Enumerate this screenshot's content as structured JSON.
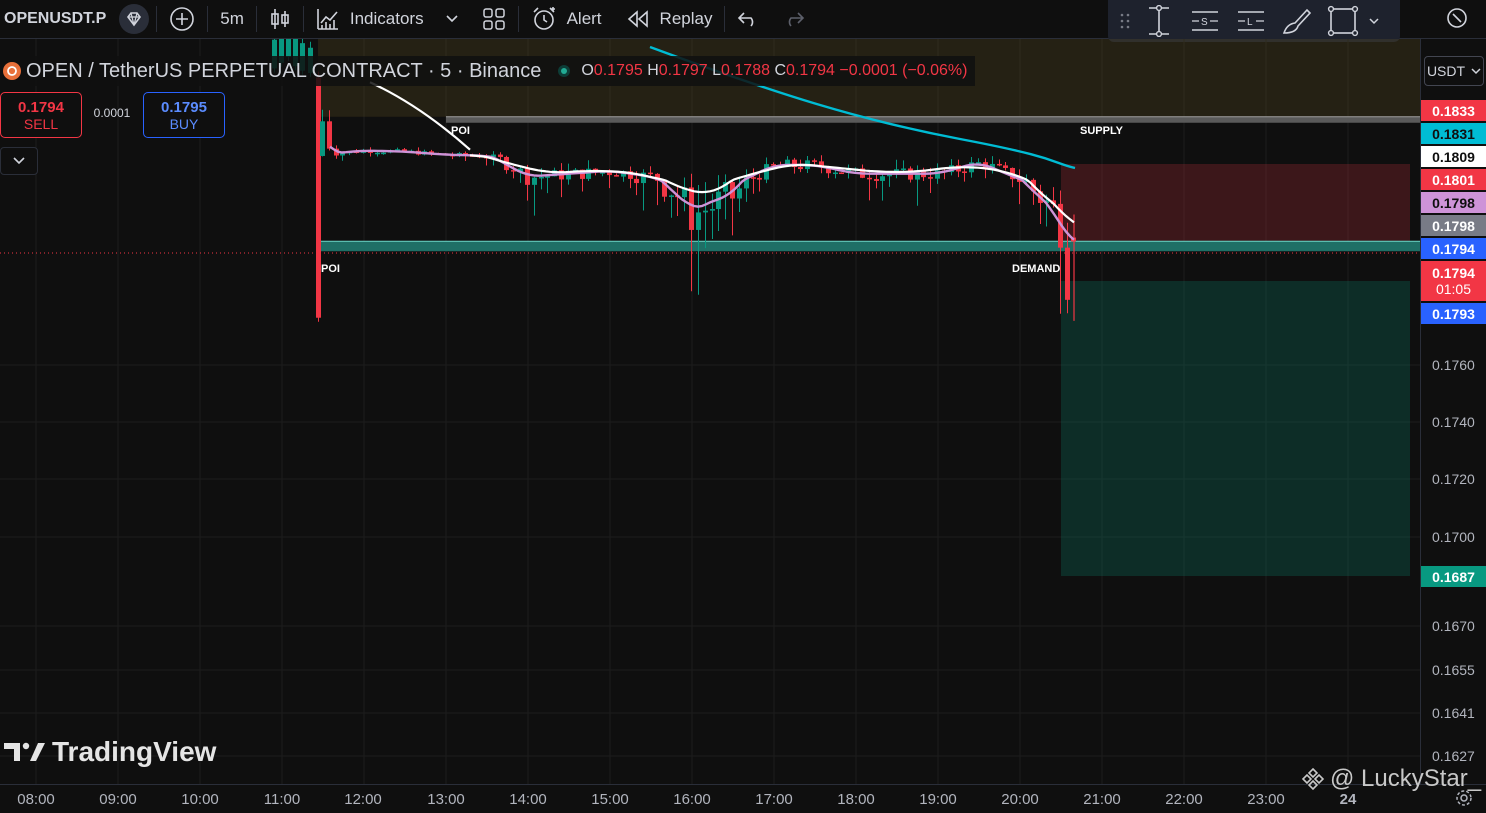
{
  "toolbar": {
    "symbol": "OPENUSDT.P",
    "interval": "5m",
    "indicators_label": "Indicators",
    "alert_label": "Alert",
    "replay_label": "Replay"
  },
  "legend": {
    "title": "OPEN / TetherUS PERPETUAL CONTRACT · 5 · Binance",
    "o_key": "O",
    "o_val": "0.1795",
    "h_key": "H",
    "h_val": "0.1797",
    "l_key": "L",
    "l_val": "0.1788",
    "c_key": "C",
    "c_val": "0.1794",
    "change": "−0.0001 (−0.06%)"
  },
  "trade": {
    "sell_price": "0.1794",
    "sell_label": "SELL",
    "spread": "0.0001",
    "buy_price": "0.1795",
    "buy_label": "BUY"
  },
  "price_axis": {
    "currency": "USDT",
    "ticks": [
      "0.1760",
      "0.1740",
      "0.1720",
      "0.1700",
      "0.1670",
      "0.1655",
      "0.1641",
      "0.1627"
    ],
    "tags": [
      {
        "text": "0.1833",
        "bg": "#f23645",
        "fg": "#ffffff"
      },
      {
        "text": "0.1831",
        "bg": "#00bcd4",
        "fg": "#0f0f0f"
      },
      {
        "text": "0.1809",
        "bg": "#ffffff",
        "fg": "#0f0f0f"
      },
      {
        "text": "0.1801",
        "bg": "#f23645",
        "fg": "#ffffff"
      },
      {
        "text": "0.1798",
        "bg": "#ce93d8",
        "fg": "#0f0f0f"
      },
      {
        "text": "0.1798",
        "bg": "#787b86",
        "fg": "#ffffff"
      },
      {
        "text": "0.1794",
        "bg": "#2962ff",
        "fg": "#ffffff"
      },
      {
        "text": "0.1794",
        "bg": "#f23645",
        "fg": "#ffffff"
      },
      {
        "text": "0.1793",
        "bg": "#2962ff",
        "fg": "#ffffff"
      },
      {
        "text": "0.1687",
        "bg": "#089981",
        "fg": "#ffffff"
      }
    ],
    "countdown": "01:05"
  },
  "time_axis": [
    "08:00",
    "09:00",
    "10:00",
    "11:00",
    "12:00",
    "13:00",
    "14:00",
    "15:00",
    "16:00",
    "17:00",
    "18:00",
    "19:00",
    "20:00",
    "21:00",
    "22:00",
    "23:00",
    "24"
  ],
  "zones": {
    "poi_top": "POI",
    "supply": "SUPPLY",
    "poi_bottom": "POI",
    "demand": "DEMAND"
  },
  "logo": "TradingView",
  "watermark": "@ LuckyStar_",
  "colors": {
    "up": "#089981",
    "down": "#f23645",
    "ema_fast": "#ce93d8",
    "ema_mid": "#ffffff",
    "ema_slow": "#00bcd4"
  },
  "chart_data": {
    "type": "candlestick",
    "symbol": "OPEN / TetherUS PERPETUAL CONTRACT",
    "timeframe": "5",
    "exchange": "Binance",
    "last": {
      "open": 0.1795,
      "high": 0.1797,
      "low": 0.1788,
      "close": 0.1794
    },
    "levels": {
      "supply": 0.1831,
      "demand": 0.1794,
      "take_profit": 0.1687,
      "stop": 0.1809
    },
    "close_series": [
      {
        "t": "11:25",
        "v": 0.184
      },
      {
        "t": "11:35",
        "v": 0.1812
      },
      {
        "t": "12:00",
        "v": 0.1815
      },
      {
        "t": "12:30",
        "v": 0.1814
      },
      {
        "t": "13:00",
        "v": 0.1811
      },
      {
        "t": "13:30",
        "v": 0.181
      },
      {
        "t": "14:00",
        "v": 0.1802
      },
      {
        "t": "14:30",
        "v": 0.1803
      },
      {
        "t": "15:00",
        "v": 0.1804
      },
      {
        "t": "15:30",
        "v": 0.1802
      },
      {
        "t": "16:00",
        "v": 0.1797
      },
      {
        "t": "16:30",
        "v": 0.1799
      },
      {
        "t": "17:00",
        "v": 0.1806
      },
      {
        "t": "17:30",
        "v": 0.1806
      },
      {
        "t": "18:00",
        "v": 0.1803
      },
      {
        "t": "18:30",
        "v": 0.1803
      },
      {
        "t": "19:00",
        "v": 0.1803
      },
      {
        "t": "19:30",
        "v": 0.1807
      },
      {
        "t": "20:00",
        "v": 0.1801
      },
      {
        "t": "20:30",
        "v": 0.1796
      },
      {
        "t": "20:40",
        "v": 0.1794
      }
    ]
  }
}
